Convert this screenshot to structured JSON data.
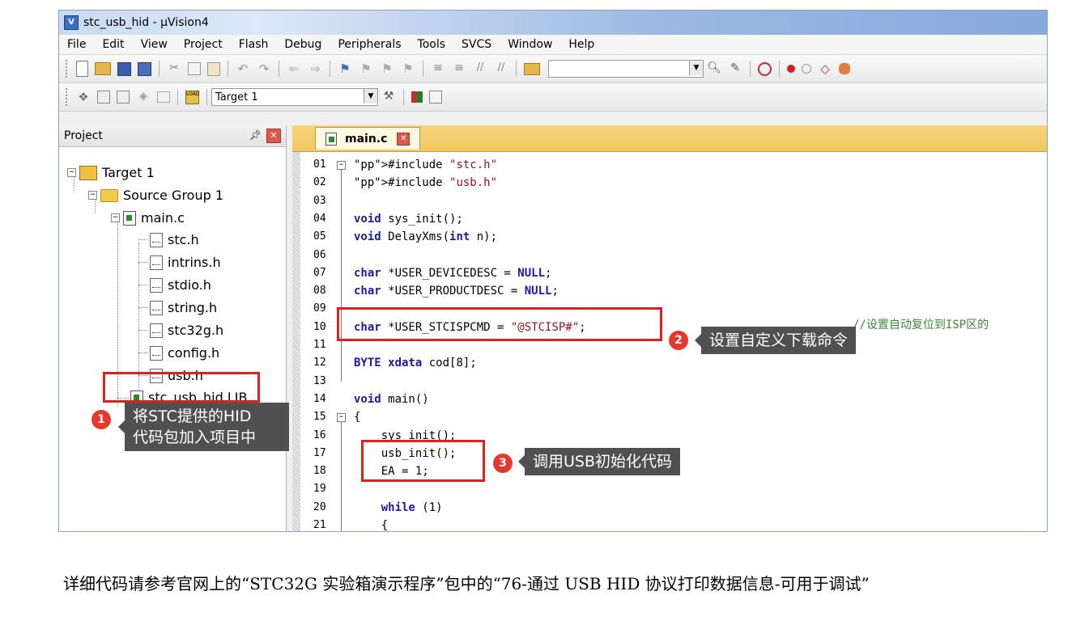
{
  "window": {
    "title": "stc_usb_hid  - µVision4"
  },
  "menu": [
    "File",
    "Edit",
    "View",
    "Project",
    "Flash",
    "Debug",
    "Peripherals",
    "Tools",
    "SVCS",
    "Window",
    "Help"
  ],
  "toolbar2": {
    "target_select": "Target 1"
  },
  "project_panel": {
    "title": "Project",
    "tree": {
      "target": "Target 1",
      "group": "Source Group 1",
      "main_file": "main.c",
      "headers": [
        "stc.h",
        "intrins.h",
        "stdio.h",
        "string.h",
        "stc32g.h",
        "config.h",
        "usb.h"
      ],
      "lib": "stc_usb_hid.LIB"
    }
  },
  "editor": {
    "tab": "main.c",
    "line_numbers": [
      "01",
      "02",
      "03",
      "04",
      "05",
      "06",
      "07",
      "08",
      "09",
      "10",
      "11",
      "12",
      "13",
      "14",
      "15",
      "16",
      "17",
      "18",
      "19",
      "20",
      "21"
    ],
    "lines": [
      "#include \"stc.h\"",
      "#include \"usb.h\"",
      "",
      "void sys_init();",
      "void DelayXms(int n);",
      "",
      "char *USER_DEVICEDESC = NULL;",
      "char *USER_PRODUCTDESC = NULL;",
      "",
      "char *USER_STCISPCMD = \"@STCISP#\";",
      "",
      "BYTE xdata cod[8];",
      "",
      "void main()",
      "{",
      "    sys_init();",
      "    usb_init();",
      "    EA = 1;",
      "",
      "    while (1)",
      "    {"
    ],
    "comment_line10": "//设置自动复位到ISP区的"
  },
  "annotations": {
    "badge1": "1",
    "callout1": "将STC提供的HID\n代码包加入项目中",
    "badge2": "2",
    "callout2": "设置自定义下载命令",
    "badge3": "3",
    "callout3": "调用USB初始化代码"
  },
  "caption": "详细代码请参考官网上的“STC32G 实验箱演示程序”包中的“76-通过 USB HID 协议打印数据信息-可用于调试”"
}
